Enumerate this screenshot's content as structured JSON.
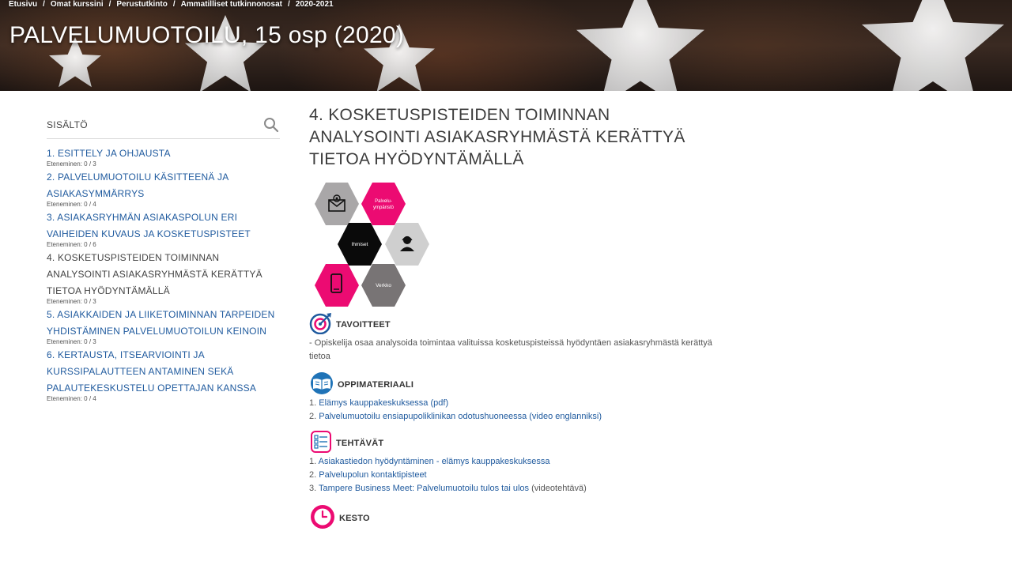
{
  "breadcrumb": [
    "Etusivu",
    "Omat kurssini",
    "Perustutkinto",
    "Ammatilliset tutkinnonosat",
    "2020-2021"
  ],
  "breadcrumb_separator": "/",
  "page_title": "PALVELUMUOTOILU, 15 osp (2020)",
  "sidebar": {
    "heading": "SISÄLTÖ",
    "items": [
      {
        "label": "1. ESITTELY JA OHJAUSTA",
        "progress": "Eteneminen: 0 / 3",
        "active": false
      },
      {
        "label": "2. PALVELUMUOTOILU KÄSITTEENÄ JA ASIAKASYMMÄRRYS",
        "progress": "Eteneminen: 0 / 4",
        "active": false
      },
      {
        "label": "3. ASIAKASRYHMÄN ASIAKASPOLUN ERI VAIHEIDEN KUVAUS JA KOSKETUSPISTEET",
        "progress": "Eteneminen: 0 / 6",
        "active": false
      },
      {
        "label": "4. KOSKETUSPISTEIDEN TOIMINNAN ANALYSOINTI ASIAKASRYHMÄSTÄ KERÄTTYÄ TIETOA HYÖDYNTÄMÄLLÄ",
        "progress": "Eteneminen: 0 / 3",
        "active": true
      },
      {
        "label": "5. ASIAKKAIDEN JA LIIKETOIMINNAN TARPEIDEN YHDISTÄMINEN PALVELUMUOTOILUN KEINOIN",
        "progress": "Eteneminen: 0 / 3",
        "active": false
      },
      {
        "label": "6. KERTAUSTA, ITSEARVIOINTI JA KURSSIPALAUTTEEN ANTAMINEN SEKÄ PALAUTEKESKUSTELU OPETTAJAN KANSSA",
        "progress": "Eteneminen: 0 / 4",
        "active": false
      }
    ]
  },
  "main": {
    "heading": "4. KOSKETUSPISTEIDEN TOIMINNAN ANALYSOINTI ASIAKASRYHMÄSTÄ KERÄTTYÄ TIETOA HYÖDYNTÄMÄLLÄ",
    "hexagons": {
      "palveluymparisto_line1": "Palvelu-",
      "palveluymparisto_line2": "ympäristö",
      "ihmiset": "Ihmiset",
      "verkko": "Verkko"
    },
    "goals": {
      "title": "TAVOITTEET",
      "text": "- Opiskelija osaa analysoida toimintaa valituissa kosketuspisteissä hyödyntäen asiakasryhmästä kerättyä tietoa"
    },
    "materials": {
      "title": "OPPIMATERIAALI",
      "items": [
        {
          "num": "1.",
          "link": "Elämys kauppakeskuksessa (pdf)"
        },
        {
          "num": "2.",
          "link": "Palvelumuotoilu ensiapupoliklinikan odotushuoneessa (video englanniksi)"
        }
      ]
    },
    "tasks": {
      "title": "TEHTÄVÄT",
      "items": [
        {
          "num": "1.",
          "link": "Asiakastiedon hyödyntäminen - elämys kauppakeskuksessa",
          "suffix": ""
        },
        {
          "num": "2.",
          "link": "Palvelupolun kontaktipisteet",
          "suffix": ""
        },
        {
          "num": "3.",
          "link": "Tampere Business Meet: Palvelumuotoilu tulos tai ulos",
          "suffix": " (videotehtävä)"
        }
      ]
    },
    "duration": {
      "title": "KESTO"
    }
  },
  "colors": {
    "link": "#1f5a9e",
    "accent_pink": "#ec0b72",
    "hex_grey_light": "#cfcfcf",
    "hex_grey_mid": "#a9a7a8",
    "hex_grey_dark": "#787475",
    "hex_black": "#0a0a0a",
    "icon_blue": "#1f73b7"
  }
}
